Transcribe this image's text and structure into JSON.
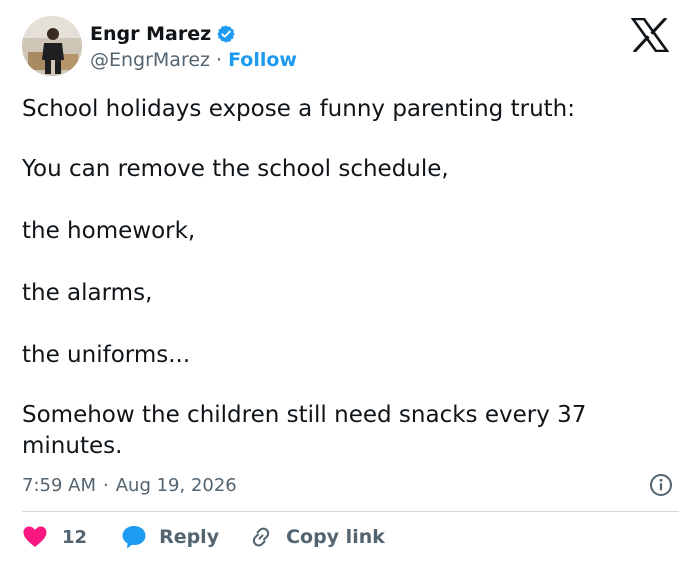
{
  "author": {
    "display_name": "Engr Marez",
    "handle": "@EngrMarez",
    "separator": "·",
    "follow_label": "Follow",
    "verified_color": "#1d9bf0",
    "avatar_icon": "avatar-photo"
  },
  "tweet": {
    "lines": [
      "School holidays expose a funny parenting truth:",
      "You can remove the school schedule,",
      "the homework,",
      "the alarms,",
      "the uniforms...",
      "Somehow the children still need snacks every 37 minutes."
    ]
  },
  "meta": {
    "time": "7:59 AM",
    "separator": "·",
    "date": "Aug 19, 2026"
  },
  "actions": {
    "like_count": "12",
    "reply_label": "Reply",
    "copy_link_label": "Copy link",
    "like_color": "#f91880",
    "reply_color": "#1d9bf0"
  },
  "icons": {
    "brand": "x-logo-icon",
    "verified": "verified-badge-icon",
    "info": "info-icon",
    "like": "heart-icon",
    "reply": "speech-bubble-icon",
    "copy": "link-icon"
  }
}
